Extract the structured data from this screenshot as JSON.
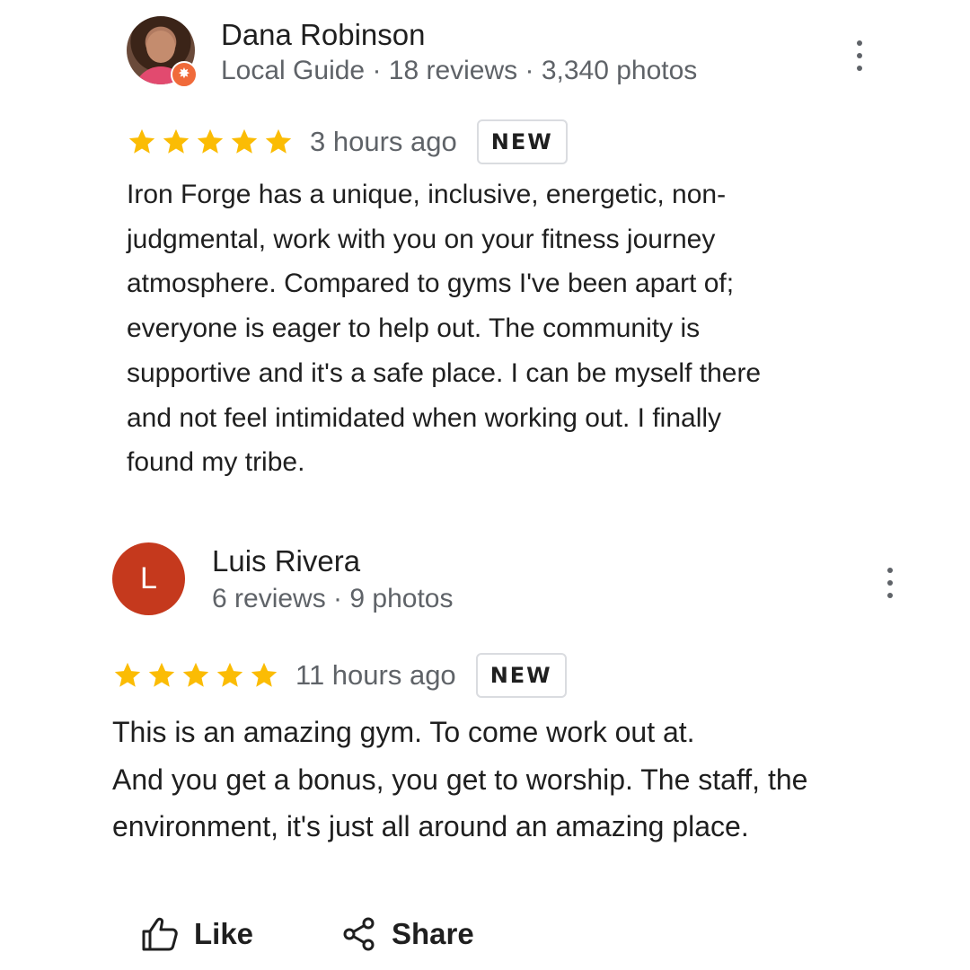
{
  "reviews": [
    {
      "author": "Dana Robinson",
      "meta": "Local Guide · 18 reviews · 3,340 photos",
      "rating": 5,
      "time": "3 hours ago",
      "badge": "NEW",
      "text": "Iron Forge has a unique, inclusive, energetic, non-\njudgmental, work with you on your fitness journey\natmosphere. Compared to gyms I've been apart of;\neveryone is eager to help out. The community is\nsupportive and it's a safe place. I can be myself there\nand not feel intimidated when working out. I finally\nfound my tribe."
    },
    {
      "author": "Luis Rivera",
      "avatar_letter": "L",
      "meta": "6 reviews · 9 photos",
      "rating": 5,
      "time": "11 hours ago",
      "badge": "NEW",
      "text": "This is an amazing gym. To come work out at.\nAnd you get a bonus, you get to worship. The staff, the\nenvironment, it's just all around an amazing place."
    }
  ],
  "actions": {
    "like_label": "Like",
    "share_label": "Share"
  },
  "colors": {
    "star": "#fbbc04",
    "avatar_letter_bg": "#c5391d",
    "local_guide_badge": "#f06a3a",
    "secondary_text": "#5f6368"
  },
  "icons": {
    "menu": "more-vert-icon",
    "like": "thumb-up-icon",
    "share": "share-icon",
    "star": "star-icon",
    "local_guide": "local-guide-badge-icon"
  }
}
